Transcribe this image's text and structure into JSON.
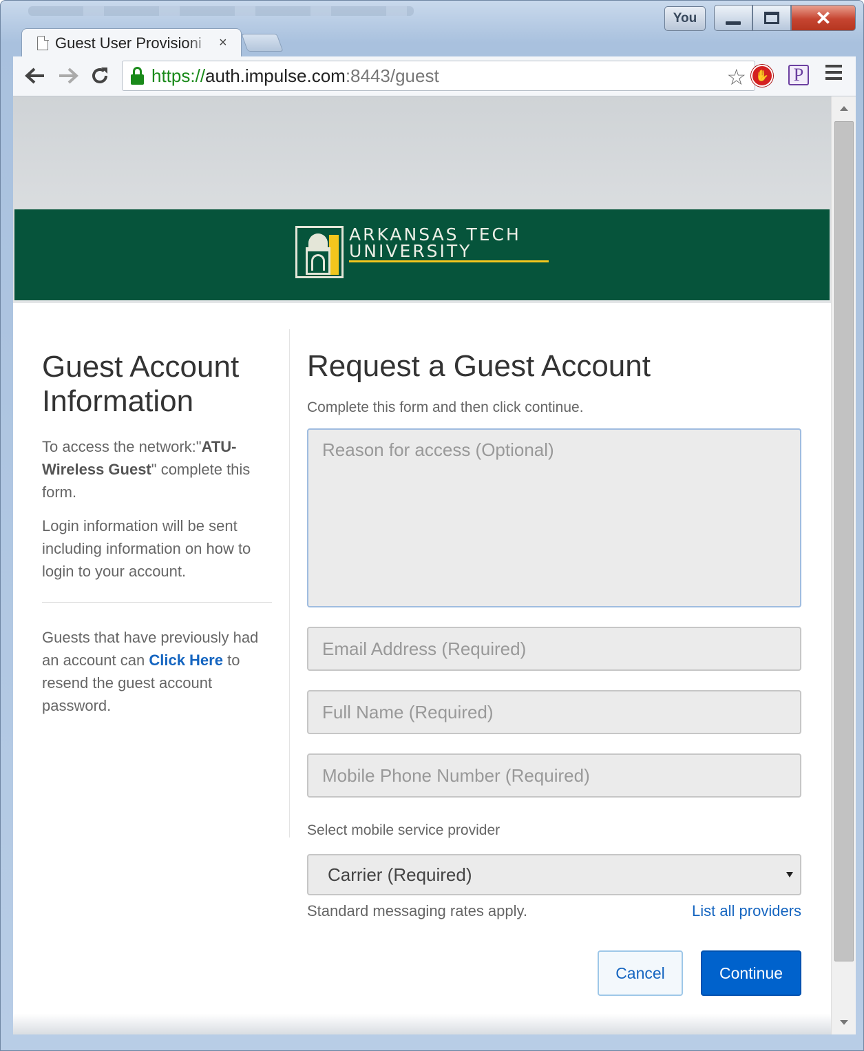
{
  "browser": {
    "profile_label": "You",
    "tab_title": "Guest User Provisioni",
    "tab_close": "×",
    "url_scheme": "https",
    "url_separator": "://",
    "url_host": "auth.impulse.com",
    "url_rest": ":8443/guest",
    "window_close": "✕"
  },
  "banner": {
    "line1": "ARKANSAS TECH",
    "line2": "UNIVERSITY",
    "colors": {
      "green": "#06543b",
      "gold": "#f3c61d"
    }
  },
  "info": {
    "title": "Guest Account Information",
    "p1_prefix": "To access the network:\"",
    "p1_network": "ATU-Wireless Guest",
    "p1_suffix": "\" complete this form.",
    "p2": "Login information will be sent including information on how to login to your account.",
    "p3_prefix": "Guests that have previously had an account can ",
    "p3_link": "Click Here",
    "p3_suffix": " to resend the guest account password."
  },
  "form": {
    "title": "Request a Guest Account",
    "subtitle": "Complete this form and then click continue.",
    "reason_placeholder": "Reason for access (Optional)",
    "email_placeholder": "Email Address (Required)",
    "name_placeholder": "Full Name (Required)",
    "phone_placeholder": "Mobile Phone Number (Required)",
    "provider_label": "Select mobile service provider",
    "carrier_selected": "Carrier (Required)",
    "rates_note": "Standard messaging rates apply.",
    "list_providers": "List all providers",
    "cancel_label": "Cancel",
    "continue_label": "Continue"
  }
}
